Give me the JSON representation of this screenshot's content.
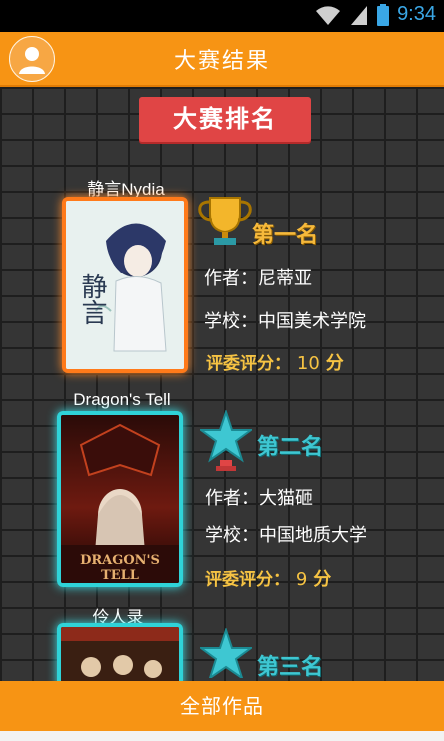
{
  "status_bar": {
    "time": "9:34"
  },
  "header": {
    "title": "大赛结果"
  },
  "ranking_banner": "大赛排名",
  "entries": [
    {
      "title": "静言Nydia",
      "rank": "第一名",
      "author": "作者：尼蒂亚",
      "school": "学校：中国美术学院",
      "score_label": "评委评分：",
      "score_value": "10",
      "score_unit": "分",
      "cover_text": "静言"
    },
    {
      "title": "Dragon's Tell",
      "rank": "第二名",
      "author": "作者：大猫砸",
      "school": "学校：中国地质大学",
      "score_label": "评委评分：",
      "score_value": "9",
      "score_unit": "分",
      "cover_text": "DRAGON'S TELL"
    },
    {
      "title": "伶人录",
      "rank": "第三名"
    }
  ],
  "bottom_button": "全部作品",
  "colors": {
    "accent": "#f79414",
    "banner": "#e04545",
    "gold": "#f6b93b",
    "teal": "#3ec7d2"
  }
}
